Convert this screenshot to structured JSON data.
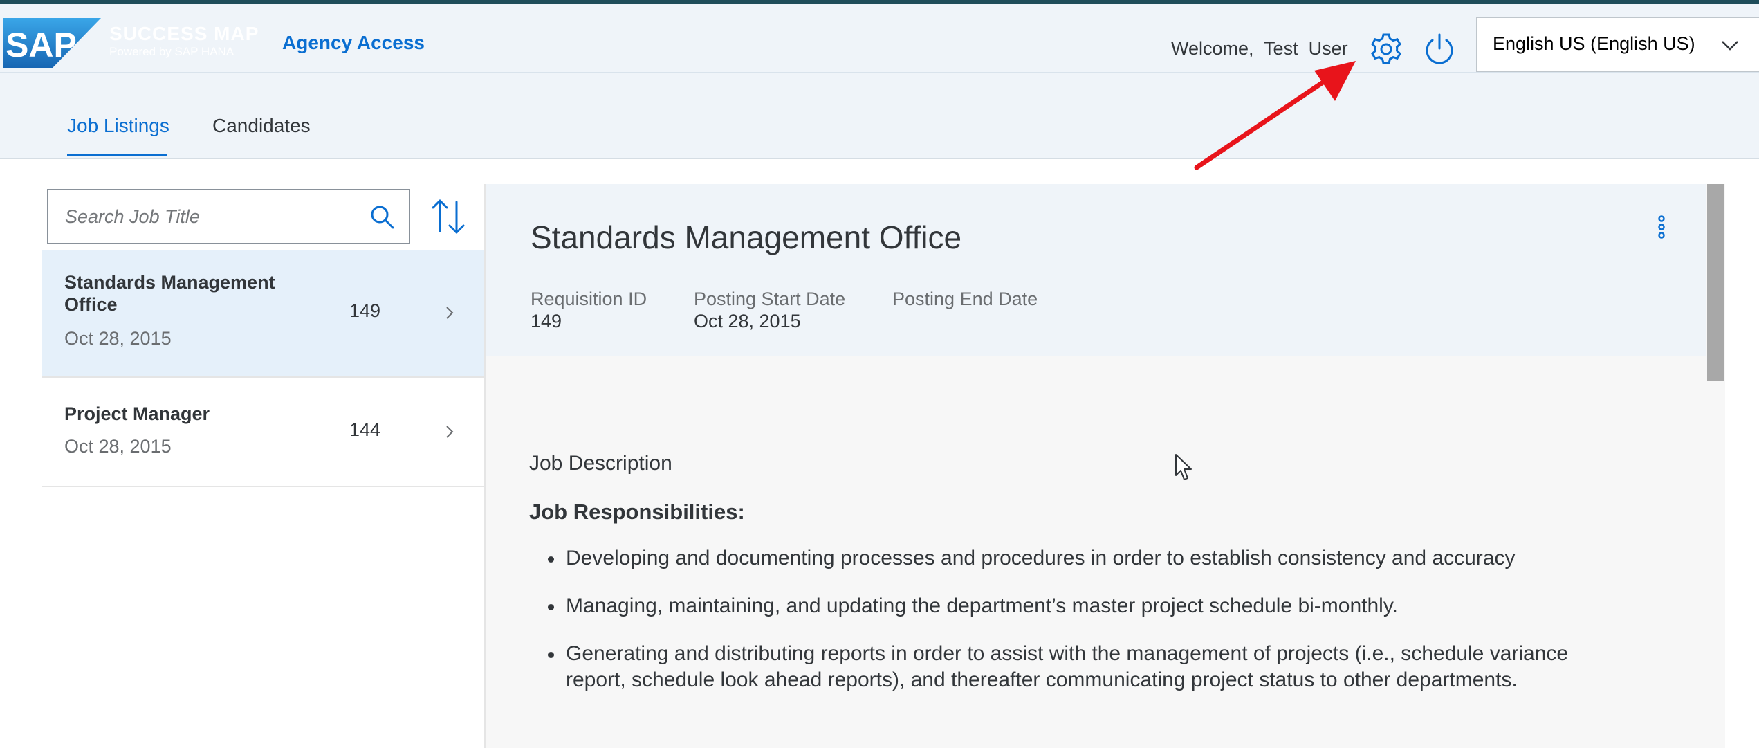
{
  "shell": {
    "logo_text": "SAP",
    "product_name": "SUCCESS MAP",
    "product_sub": "Powered by SAP HANA",
    "app_title": "Agency Access",
    "welcome": "Welcome,  Test  User",
    "language": "English US (English US)"
  },
  "tabs": [
    {
      "label": "Job Listings",
      "selected": true
    },
    {
      "label": "Candidates",
      "selected": false
    }
  ],
  "search": {
    "placeholder": "Search Job Title",
    "value": ""
  },
  "list": [
    {
      "title": "Standards Management Office",
      "date": "Oct 28, 2015",
      "id": "149",
      "selected": true
    },
    {
      "title": "Project Manager",
      "date": "Oct 28, 2015",
      "id": "144",
      "selected": false
    }
  ],
  "detail": {
    "title": "Standards Management Office",
    "attributes": [
      {
        "label": "Requisition ID",
        "value": "149"
      },
      {
        "label": "Posting Start Date",
        "value": "Oct 28, 2015"
      },
      {
        "label": "Posting End Date",
        "value": ""
      }
    ],
    "section_title": "Job Description",
    "responsibilities_title": "Job Responsibilities:",
    "responsibilities": [
      "Developing and documenting processes and procedures in order to establish consistency and accuracy",
      "Managing, maintaining, and updating the department’s master project schedule bi-monthly.",
      "Generating and distributing reports in order to assist with the management of projects (i.e., schedule variance report, schedule look ahead reports), and thereafter communicating project status to other departments."
    ]
  },
  "colors": {
    "accent": "#0a6ed1",
    "shell_bg": "#eff4f9",
    "selected_row": "#e5f0fa",
    "annotation": "#e8141b"
  },
  "icons": [
    "settings-gear-icon",
    "power-icon",
    "chevron-down-icon",
    "search-icon",
    "sort-icon",
    "chevron-right-icon",
    "overflow-icon"
  ]
}
